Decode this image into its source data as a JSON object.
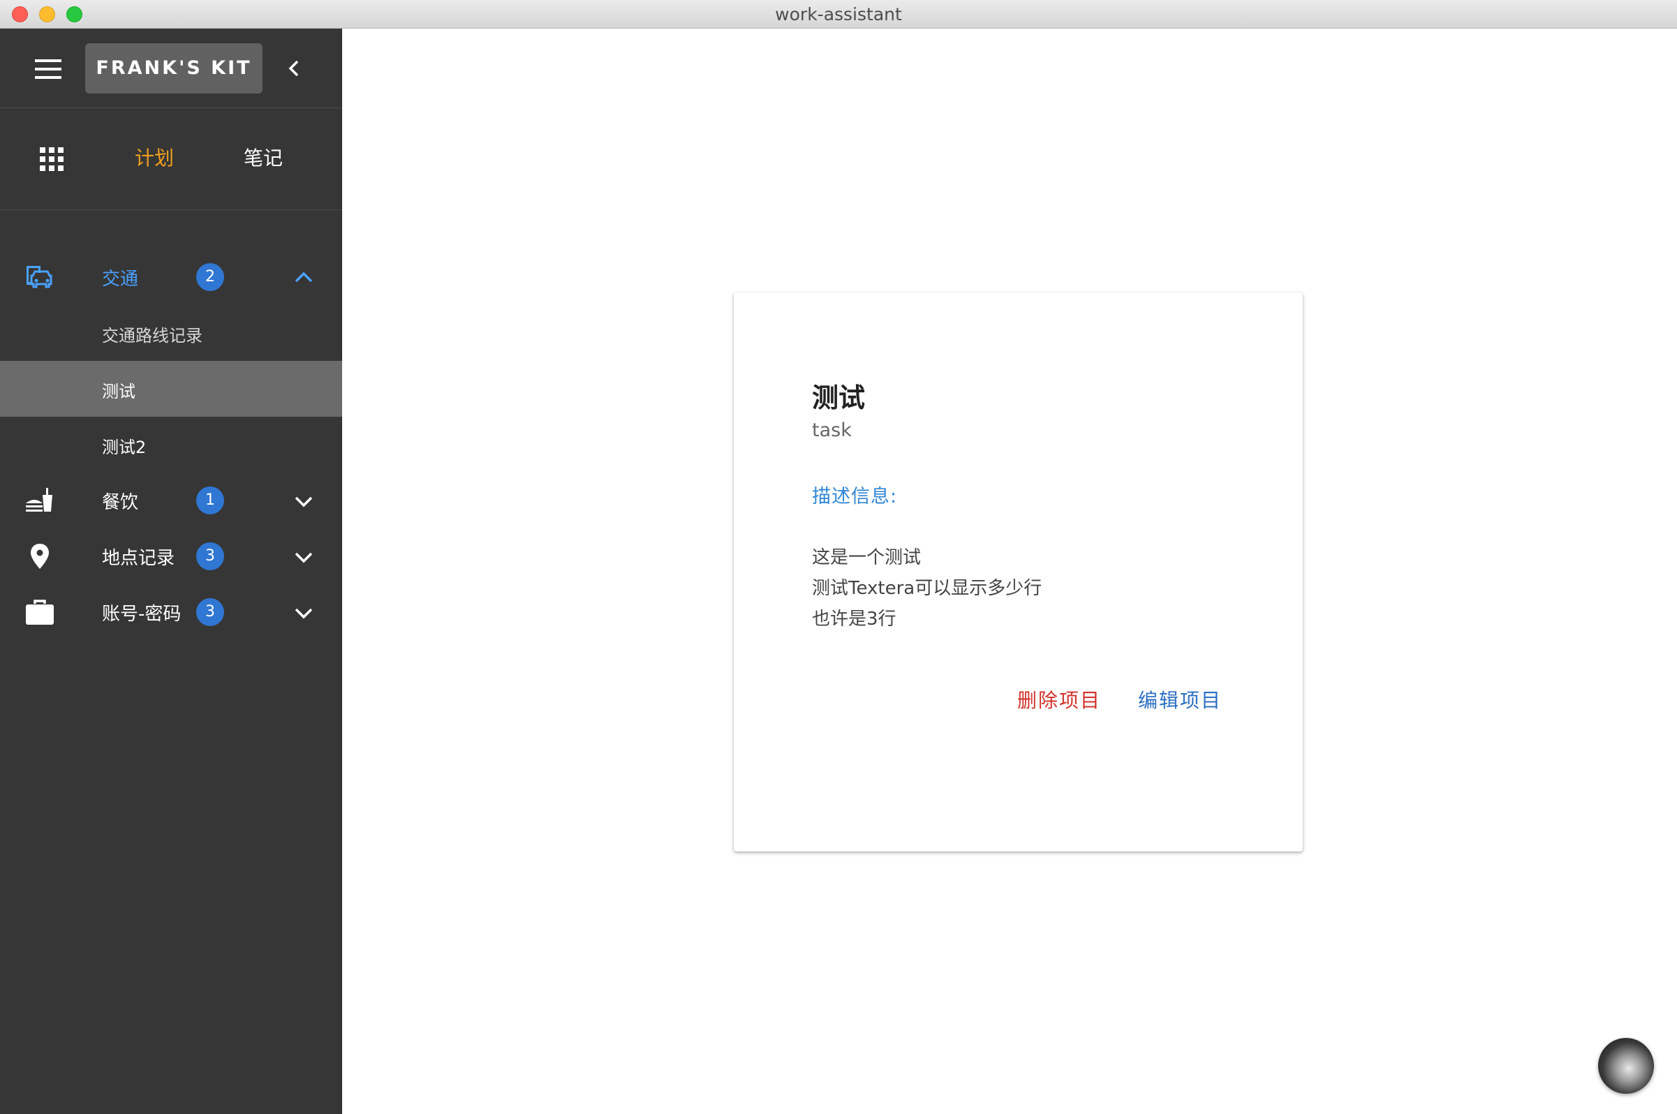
{
  "window": {
    "title": "work-assistant"
  },
  "sidebar": {
    "brand": "FRANK'S KIT",
    "tabs": {
      "plan": "计划",
      "notes": "笔记"
    },
    "categories": [
      {
        "label": "交通",
        "badge": "2",
        "icon": "car-icon",
        "expanded": true,
        "items": [
          "交通路线记录",
          "测试",
          "测试2"
        ]
      },
      {
        "label": "餐饮",
        "badge": "1",
        "icon": "fastfood-icon"
      },
      {
        "label": "地点记录",
        "badge": "3",
        "icon": "location-pin-icon"
      },
      {
        "label": "账号-密码",
        "badge": "3",
        "icon": "briefcase-icon"
      }
    ]
  },
  "card": {
    "title": "测试",
    "subtitle": "task",
    "description_label": "描述信息:",
    "description_lines": [
      "这是一个测试",
      "测试Textera可以显示多少行",
      "也许是3行"
    ],
    "delete_label": "删除项目",
    "edit_label": "编辑项目"
  },
  "colors": {
    "sidebar_bg": "#363636",
    "active_tab": "#f0a01e",
    "active_category": "#4aa2ff",
    "badge": "#2f77d3",
    "delete": "#d0322a",
    "edit": "#2b6fc2"
  }
}
